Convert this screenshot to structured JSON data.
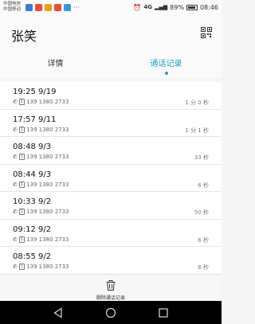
{
  "status": {
    "carrier1": "中国电信",
    "carrier2": "中国移动",
    "net": "4G",
    "battery": "89%",
    "time": "08:46"
  },
  "header": {
    "name": "张笑"
  },
  "tabs": [
    {
      "label": "详情",
      "active": false
    },
    {
      "label": "通话记录",
      "active": true
    }
  ],
  "calls": [
    {
      "time": "19:25 9/19",
      "number": "139 1380 2733",
      "duration": "1 分 0 秒"
    },
    {
      "time": "17:57 9/11",
      "number": "139 1380 2733",
      "duration": "1 分 1 秒"
    },
    {
      "time": "08:48 9/3",
      "number": "139 1380 2733",
      "duration": "33 秒"
    },
    {
      "time": "08:44 9/3",
      "number": "139 1380 2733",
      "duration": "6 秒"
    },
    {
      "time": "10:33 9/2",
      "number": "139 1380 2733",
      "duration": "50 秒"
    },
    {
      "time": "09:12 9/2",
      "number": "139 1380 2733",
      "duration": "6 秒"
    },
    {
      "time": "08:55 9/2",
      "number": "139 1380 2733",
      "duration": "6 秒"
    }
  ],
  "bottom": {
    "delete_label": "删除通话记录"
  },
  "colors": {
    "accent": "#1ba0c4"
  }
}
